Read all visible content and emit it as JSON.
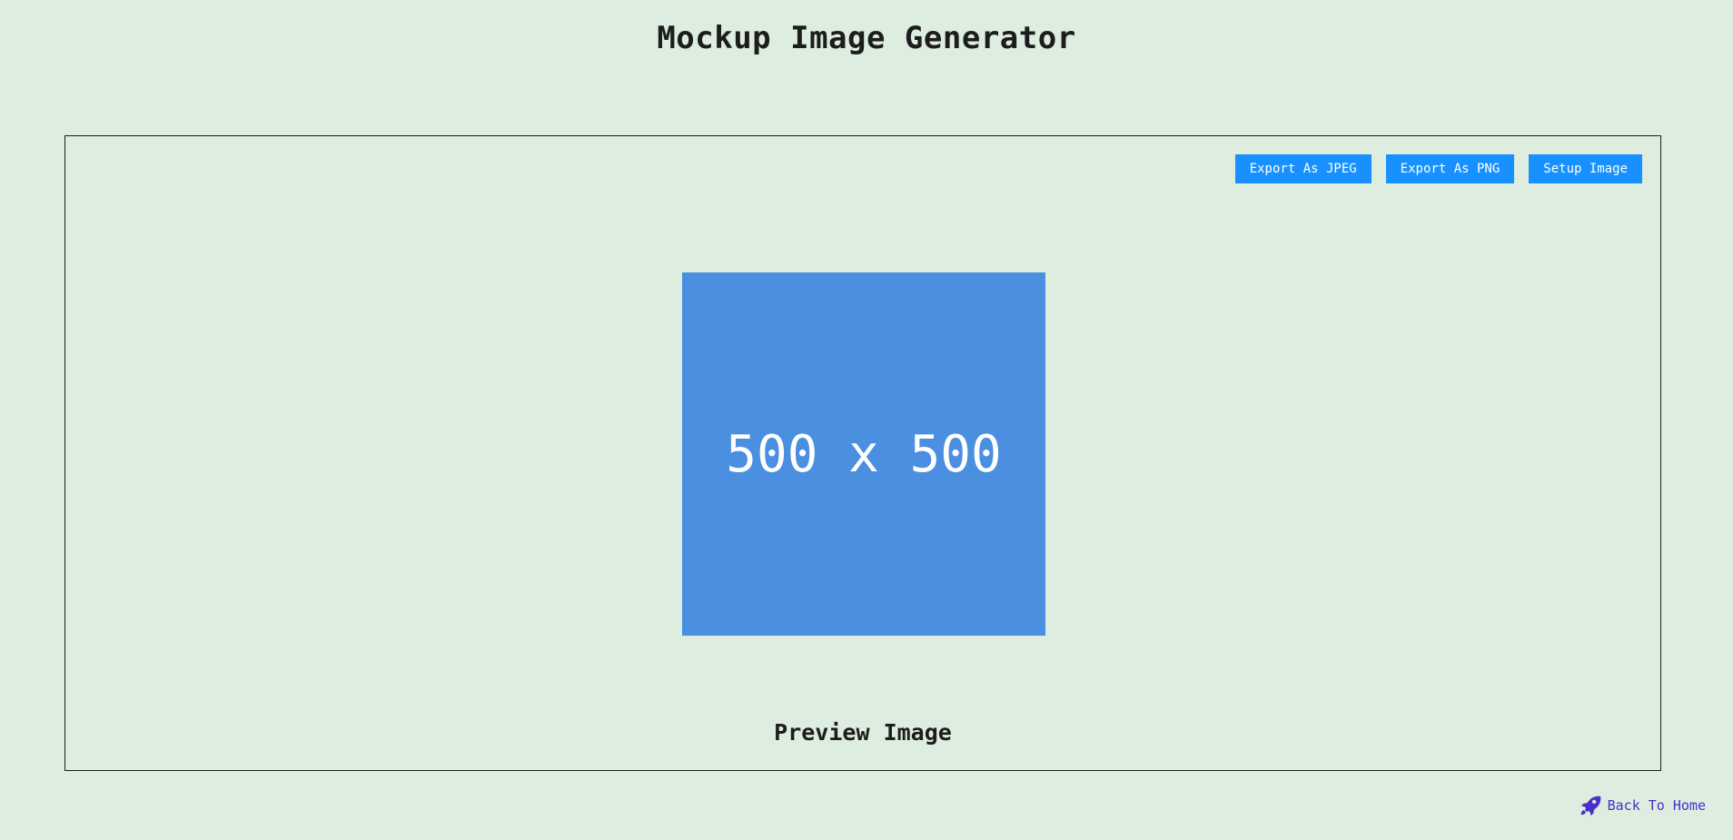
{
  "header": {
    "title": "Mockup Image Generator"
  },
  "toolbar": {
    "export_jpeg_label": "Export As JPEG",
    "export_png_label": "Export As PNG",
    "setup_image_label": "Setup Image"
  },
  "preview": {
    "image_label": "500 x 500",
    "image_color": "#4a8fe0",
    "caption": "Preview Image"
  },
  "footer": {
    "back_label": "Back To Home",
    "back_icon": "rocket-icon",
    "link_color": "#4b2fc9"
  },
  "colors": {
    "background": "#ddede0",
    "button": "#1890ff"
  }
}
